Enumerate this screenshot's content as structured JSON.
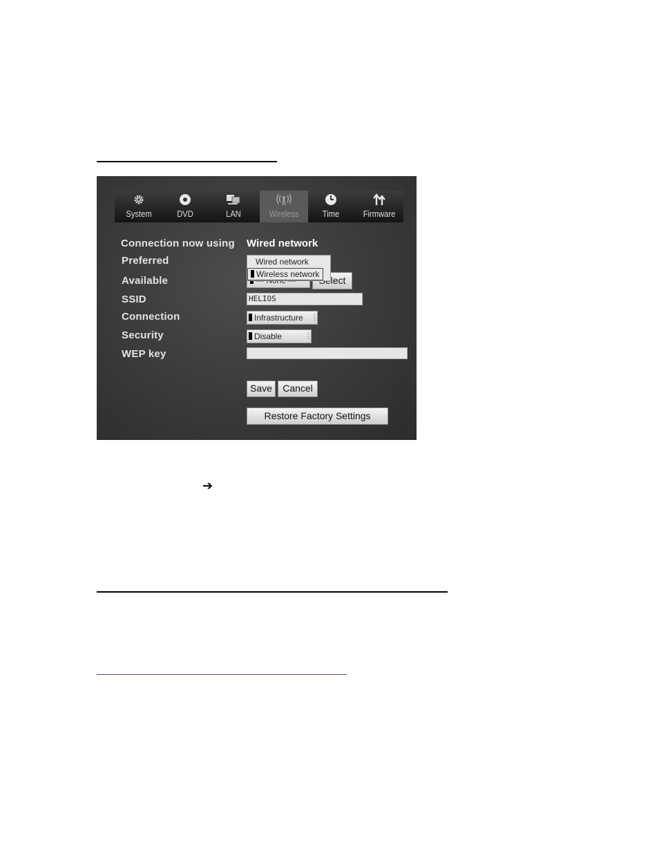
{
  "tabs": [
    {
      "label": "System",
      "icon": "gear-icon"
    },
    {
      "label": "DVD",
      "icon": "disc-icon"
    },
    {
      "label": "LAN",
      "icon": "computers-icon"
    },
    {
      "label": "Wireless",
      "icon": "wireless-antenna-icon",
      "active": true
    },
    {
      "label": "Time",
      "icon": "clock-icon"
    },
    {
      "label": "Firmware",
      "icon": "up-arrows-icon"
    }
  ],
  "form": {
    "connection_label": "Connection now using",
    "connection_value": "Wired network",
    "preferred_label": "Preferred",
    "available_label": "Available",
    "ssid_label": "SSID",
    "connection_type_label": "Connection",
    "security_label": "Security",
    "wep_label": "WEP key",
    "preferred_options": [
      "Wired network",
      "Wireless network"
    ],
    "preferred_selected": "Wireless network",
    "available_value": "--- None ---",
    "select_button": "Select",
    "ssid_value": "HELIOS",
    "connection_type_value": "Infrastructure",
    "security_value": "Disable",
    "wep_value": "",
    "save_button": "Save",
    "cancel_button": "Cancel",
    "restore_button": "Restore Factory Settings"
  },
  "doc": {
    "arrow_glyph": "➔"
  }
}
